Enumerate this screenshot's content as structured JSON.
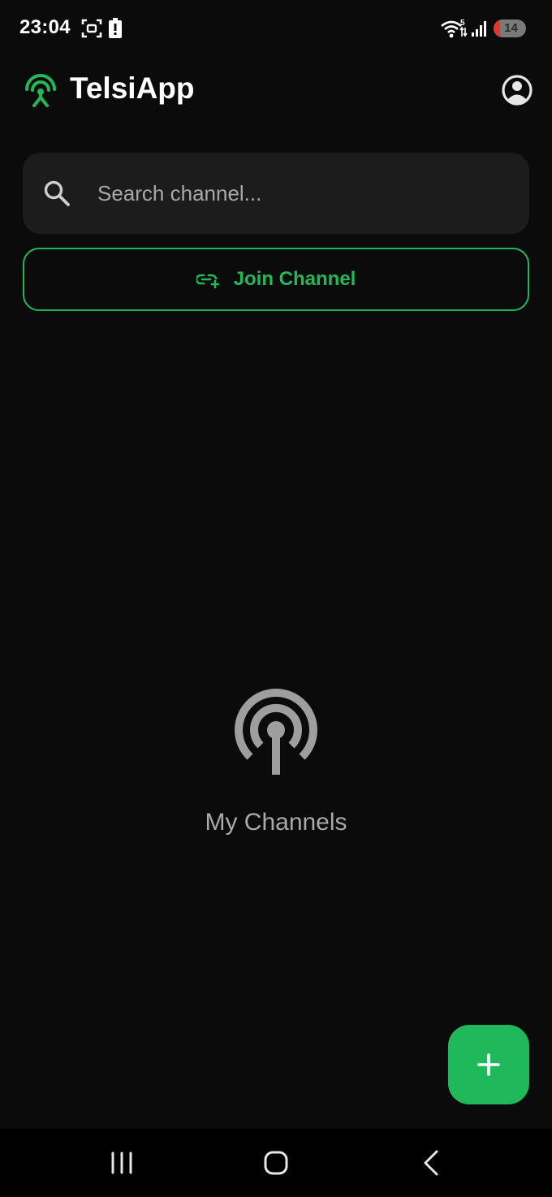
{
  "status_bar": {
    "time": "23:04",
    "battery_level": "14"
  },
  "app_bar": {
    "title": "TelsiApp"
  },
  "search": {
    "placeholder": "Search channel..."
  },
  "join_button": {
    "label": "Join Channel"
  },
  "empty_state": {
    "label": "My Channels"
  },
  "colors": {
    "accent": "#22b85a",
    "background": "#0b0b0b",
    "search_bg": "#1c1c1c",
    "muted_text": "#a9a9a9"
  },
  "icons": {
    "logo": "antenna-icon",
    "profile": "account-circle-icon",
    "search": "search-icon",
    "join": "link-add-icon",
    "empty": "podcast-antenna-icon",
    "fab": "plus-icon"
  }
}
